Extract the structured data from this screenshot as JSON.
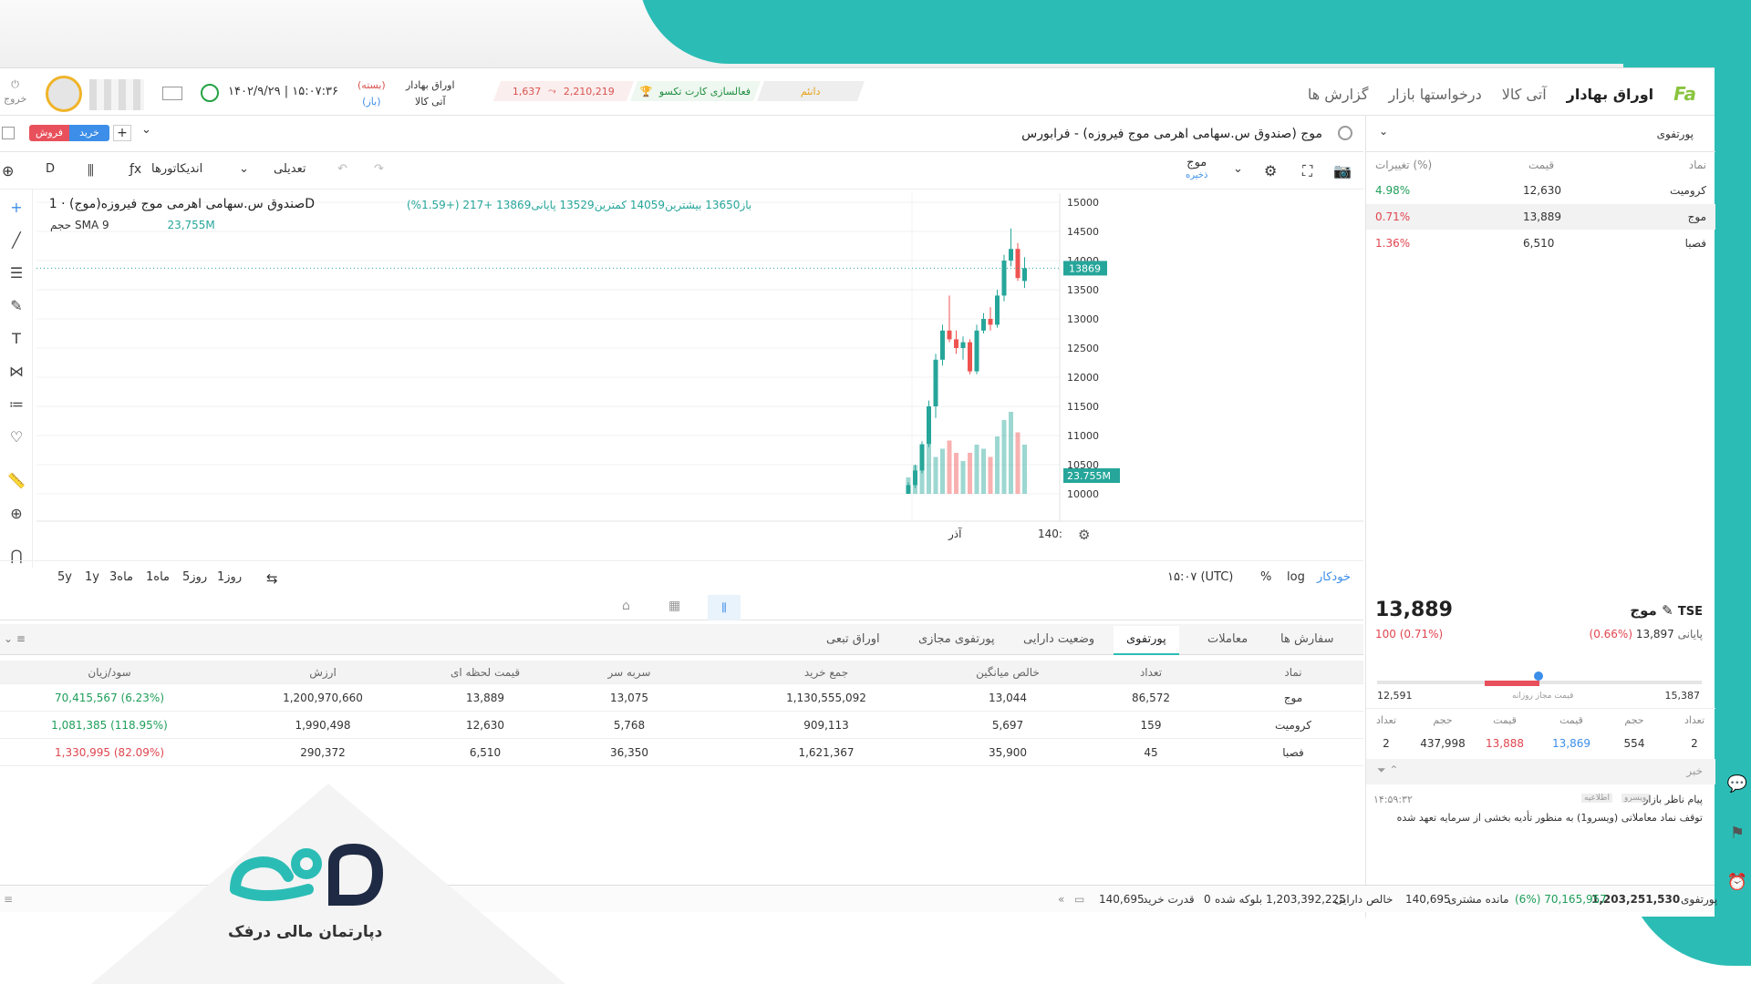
{
  "nav": {
    "logo": "Fa",
    "items": [
      "اوراق بهادار",
      "آتی کالا",
      "درخواستها بازار",
      "گزارش ها"
    ]
  },
  "header": {
    "ticker_daneem": "دانئم",
    "ticker_activation": "فعالسازی کارت تکسو",
    "index_value": "2,210,219",
    "index_change": "1,637",
    "market1_name": "اوراق بهادار",
    "market1_state": "(بسته)",
    "market2_name": "آتی کالا",
    "market2_state": "(باز)",
    "datetime": "۱۴۰۲/۹/۲۹ | ۱۵:۰۷:۳۶",
    "logout": "خروج"
  },
  "symbol": {
    "title": "موج (صندوق س.سهامی اهرمی موج فیروزه) - فرابورس",
    "sell": "فروش",
    "buy": "خرید",
    "plus": "+"
  },
  "toolbar": {
    "interval": "D",
    "indicators": "اندیکاتورها",
    "adjust": "تعدیلی",
    "layout_name": "موج",
    "layout_saved": "ذخیره"
  },
  "chart": {
    "legend_title": "صندوق س.سهامی اهرمی موج فیروزه(موج) · 1D",
    "ohlc_label": "باز13650  بیشترین14059  کمترین13529  پایانی13869  +217 (+1.59%)",
    "sma_label": "حجم SMA 9",
    "sma_value": "23,755M",
    "last_price_tag": "13869",
    "volume_tag": "23.755M",
    "x_label_month": "آذر",
    "x_label_year": "140:"
  },
  "chart_data": {
    "type": "bar",
    "title": "صندوق س.سهامی اهرمی موج فیروزه(موج) · 1D",
    "ylim": [
      10000,
      15000
    ],
    "yticks": [
      10000,
      10500,
      11000,
      11500,
      12000,
      12500,
      13000,
      13500,
      14000,
      14500,
      15000
    ],
    "candles": [
      {
        "o": 10000,
        "h": 10200,
        "l": 10000,
        "c": 10150
      },
      {
        "o": 10150,
        "h": 10500,
        "l": 10100,
        "c": 10400
      },
      {
        "o": 10400,
        "h": 10900,
        "l": 10350,
        "c": 10850
      },
      {
        "o": 10850,
        "h": 11600,
        "l": 10800,
        "c": 11500
      },
      {
        "o": 11500,
        "h": 12400,
        "l": 11300,
        "c": 12300
      },
      {
        "o": 12300,
        "h": 12900,
        "l": 12200,
        "c": 12800
      },
      {
        "o": 12800,
        "h": 13400,
        "l": 12600,
        "c": 12650
      },
      {
        "o": 12650,
        "h": 12800,
        "l": 12400,
        "c": 12500
      },
      {
        "o": 12500,
        "h": 12700,
        "l": 12300,
        "c": 12600
      },
      {
        "o": 12600,
        "h": 12650,
        "l": 12050,
        "c": 12100
      },
      {
        "o": 12100,
        "h": 12900,
        "l": 12050,
        "c": 12800
      },
      {
        "o": 12800,
        "h": 13100,
        "l": 12750,
        "c": 13000
      },
      {
        "o": 13000,
        "h": 13200,
        "l": 12800,
        "c": 12900
      },
      {
        "o": 12900,
        "h": 13500,
        "l": 12850,
        "c": 13400
      },
      {
        "o": 13400,
        "h": 14100,
        "l": 13300,
        "c": 14000
      },
      {
        "o": 14000,
        "h": 14550,
        "l": 13900,
        "c": 14200
      },
      {
        "o": 14200,
        "h": 14300,
        "l": 13650,
        "c": 13700
      },
      {
        "o": 13650,
        "h": 14059,
        "l": 13529,
        "c": 13869
      }
    ],
    "volume_rel": [
      0.2,
      0.35,
      0.55,
      0.6,
      0.45,
      0.55,
      0.65,
      0.5,
      0.4,
      0.5,
      0.6,
      0.55,
      0.45,
      0.7,
      0.9,
      1.0,
      0.75,
      0.6
    ]
  },
  "bottom_tools": {
    "periods": [
      "5y",
      "1y",
      "3ماه",
      "1ماه",
      "5روز",
      "1روز"
    ],
    "timezone": "۱۵:۰۷ (UTC)",
    "percent": "%",
    "log": "log",
    "auto": "خودکار"
  },
  "panel": {
    "tabs": [
      "سفارش ها",
      "معاملات",
      "پورتفوی",
      "وضعیت دارایی",
      "پورتفوی مجازی",
      "اوراق تبعی"
    ],
    "active_tab": "پورتفوی",
    "columns": [
      "نماد",
      "تعداد",
      "خالص میانگین",
      "جمع خرید",
      "سربه سر",
      "قیمت لحظه ای",
      "ارزش",
      "سود/زیان"
    ],
    "rows": [
      [
        "موج",
        "86,572",
        "13,044",
        "1,130,555,092",
        "13,075",
        "13,889",
        "1,200,970,660",
        "70,415,567 (6.23%)"
      ],
      [
        "کرومیت",
        "159",
        "5,697",
        "909,113",
        "5,768",
        "12,630",
        "1,990,498",
        "1,081,385 (118.95%)"
      ],
      [
        "فصبا",
        "45",
        "35,900",
        "1,621,367",
        "36,350",
        "6,510",
        "290,372",
        "1,330,995 (82.09%)"
      ]
    ],
    "row_status": [
      "pos",
      "pos",
      "neg"
    ]
  },
  "watchlist": {
    "name": "پورتفوی",
    "columns": [
      "نماد",
      "قیمت",
      "تغییرات (%)"
    ],
    "rows": [
      [
        "کرومیت",
        "12,630",
        "4.98%"
      ],
      [
        "موج",
        "13,889",
        "0.71%"
      ],
      [
        "فصبا",
        "6,510",
        "1.36%"
      ]
    ],
    "row_status": [
      "pos",
      "neg",
      "neg"
    ]
  },
  "quote": {
    "symbol": "موج",
    "market": "TSE",
    "last": "13,889",
    "change": "100 (0.71%)",
    "close_label": "پایانی",
    "close": "13,897",
    "close_change": "(0.66%)",
    "range_low": "12,591",
    "range_high": "15,387",
    "range_label": "قیمت مجاز روزانه"
  },
  "orderbook": {
    "columns": [
      "تعداد",
      "حجم",
      "قیمت",
      "قیمت",
      "حجم",
      "تعداد"
    ],
    "row": [
      "2",
      "437,998",
      "13,888",
      "13,869",
      "554",
      "2"
    ]
  },
  "news": {
    "title": "خبر",
    "source": "پیام ناظر بازار",
    "tag1": "ویسرو",
    "tag2": "اطلاعیه",
    "time": "۱۴:۵۹:۳۲",
    "text": "توقف نماد معاملاتی (ویسرو1) به منظور تأدیه بخشی از سرمایه تعهد شده"
  },
  "status": {
    "portfolio_label": "پورتفوی",
    "portfolio_value": "1,203,251,530",
    "portfolio_change": "(6%) 70,165,957",
    "balance_label": "مانده مشتری",
    "balance_value": "140,695",
    "net_label": "خالص دارایی",
    "net_value": "1,203,392,225",
    "blocked_label": "بلوکه شده",
    "blocked_value": "0",
    "power_label": "قدرت خرید",
    "power_value": "140,695"
  },
  "brand": {
    "subtitle": "دپارتمان مالی درفک"
  },
  "colors": {
    "up": "#26a69a",
    "down": "#ef5350",
    "teal": "#2bbdb5",
    "accent_blue": "#3c8ee8"
  }
}
